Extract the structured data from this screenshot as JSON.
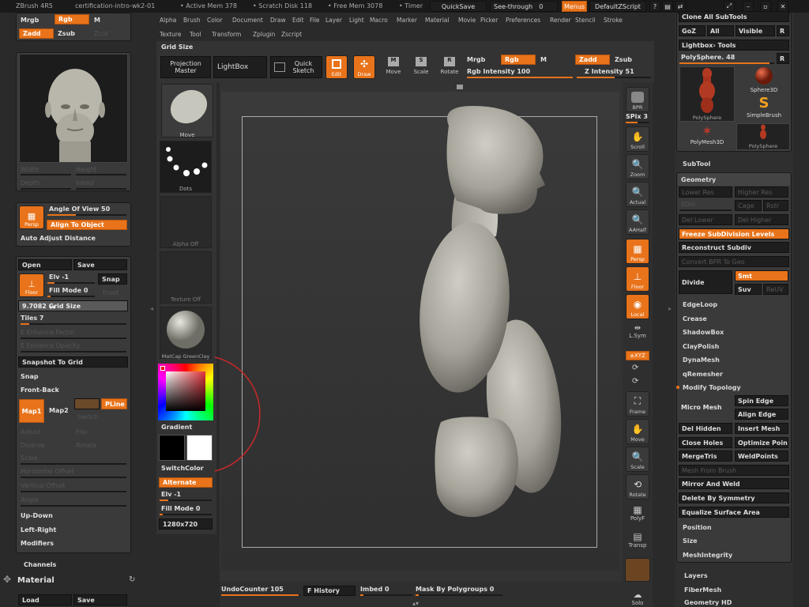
{
  "titlebar": {
    "app": "ZBrush 4R5",
    "file": "certification-intro-wk2-01",
    "active_mem": "• Active Mem 378",
    "scratch": "• Scratch Disk 118",
    "free_mem": "• Free Mem 3078",
    "timer": "• Timer",
    "quicksave": "QuickSave",
    "seethrough": "See-through",
    "seethrough_val": "0",
    "menus": "Menus",
    "zscript": "DefaultZScript"
  },
  "menu_row1": [
    "Alpha",
    "Brush",
    "Color",
    "Document",
    "Draw",
    "Edit",
    "File",
    "Layer",
    "Light",
    "Macro",
    "Marker",
    "Material",
    "Movie",
    "Picker",
    "Preferences",
    "Render",
    "Stencil",
    "Stroke"
  ],
  "menu_row2": [
    "Texture",
    "Tool",
    "Transform",
    "Zplugin",
    "Zscript"
  ],
  "shelf": {
    "grid_size": "Grid Size",
    "projection_master": "Projection Master",
    "lightbox": "LightBox",
    "quick_sketch": "Quick Sketch",
    "edit": "Edit",
    "draw": "Draw",
    "move": "Move",
    "scale": "Scale",
    "rotate": "Rotate",
    "mrgb": "Mrgb",
    "rgb": "Rgb",
    "m": "M",
    "zadd": "Zadd",
    "zsub": "Zsub",
    "rgb_intensity": "Rgb Intensity 100",
    "z_intensity": "Z Intensity 51"
  },
  "left": {
    "mrgb": "Mrgb",
    "rgb": "Rgb",
    "m": "M",
    "zadd": "Zadd",
    "zsub": "Zsub",
    "zcut": "Zcut",
    "width": "Width",
    "height": "Height",
    "depth": "Depth",
    "inbed": "Inbed",
    "persp": "Persp",
    "angle_of_view": "Angle Of View 50",
    "align_to_object": "Align To Object",
    "auto_adjust": "Auto Adjust Distance",
    "open": "Open",
    "save": "Save",
    "floor": "Floor",
    "elv": "Elv -1",
    "fill_mode": "Fill Mode 0",
    "snap": "Snap",
    "front": "Front",
    "grid_size": "9.7082 Grid Size",
    "tiles": "Tiles 7",
    "enhance_factor": "E Enhance Factor",
    "enhance_opacity": "E Enhance Opacity",
    "snapshot_to_grid": "Snapshot To Grid",
    "snap2": "Snap",
    "front_back": "Front-Back",
    "map1": "Map1",
    "map2": "Map2",
    "pline": "PLine",
    "switch": "Switch",
    "adjust": "Adjust",
    "flip": "Flip",
    "diverse": "Diverse",
    "rotate": "Rotate",
    "scale": "Scale",
    "h_offset": "Horizontal Offset",
    "v_offset": "Vertical Offset",
    "angle": "Angle",
    "up_down": "Up-Down",
    "left_right": "Left-Right",
    "modifiers": "Modifiers",
    "channels": "Channels",
    "material": "Material",
    "load": "Load",
    "save2": "Save"
  },
  "palette": {
    "move": "Move",
    "dots": "Dots",
    "alpha_off": "Alpha Off",
    "texture_off": "Texture Off",
    "matcap": "MatCap GreenClay",
    "gradient": "Gradient",
    "switch_color": "SwitchColor",
    "alternate": "Alternate",
    "elv": "Elv -1",
    "fill_mode": "Fill Mode 0",
    "doc_size": "1280x720"
  },
  "rightshelf": {
    "bpr": "BPR",
    "spix": "SPix 3",
    "scroll": "Scroll",
    "zoom": "Zoom",
    "actual": "Actual",
    "aahalf": "AAHalf",
    "persp": "Persp",
    "floor": "Floor",
    "local": "Local",
    "lsym": "L.Sym",
    "xyz": "±XYZ",
    "frame": "Frame",
    "move": "Move",
    "scale": "Scale",
    "rotate": "Rotate",
    "polyf": "PolyF",
    "transp": "Transp",
    "solo": "Solo"
  },
  "bottom": {
    "undo": "UndoCounter 105",
    "history": "F History",
    "imbed": "Imbed 0",
    "mask": "Mask By Polygroups 0"
  },
  "tool": {
    "clone_all": "Clone All SubTools",
    "goz": "GoZ",
    "all": "All",
    "visible": "Visible",
    "r": "R",
    "lightbox_tools": "Lightbox› Tools",
    "polysphere_label": "PolySphere. 48",
    "r2": "R",
    "thumbs": [
      "PolySphere",
      "Sphere3D",
      "SimpleBrush",
      "PolyMesh3D",
      "PolySphere"
    ],
    "subtool": "SubTool",
    "geometry": "Geometry",
    "lower_res": "Lower Res",
    "higher_res": "Higher Res",
    "sdiv": "SDiv",
    "cage": "Cage",
    "rstr": "Rstr",
    "del_lower": "Del Lower",
    "del_higher": "Del Higher",
    "freeze": "Freeze SubDivision Levels",
    "reconstruct": "Reconstruct Subdiv",
    "convert_bpr": "Convert BPR To Geo",
    "divide": "Divide",
    "smt": "Smt",
    "suv": "Suv",
    "reuv": "ReUV",
    "edgeloop": "EdgeLoop",
    "crease": "Crease",
    "shadowbox": "ShadowBox",
    "claypolish": "ClayPolish",
    "dynamesh": "DynaMesh",
    "qremesher": "qRemesher",
    "modify_topology": "Modify Topology",
    "spin_edge": "Spin Edge",
    "align_edge": "Align Edge",
    "micro_mesh": "Micro Mesh",
    "del_hidden": "Del Hidden",
    "insert_mesh": "Insert Mesh",
    "close_holes": "Close Holes",
    "optimize": "Optimize Poin",
    "mergetris": "MergeTris",
    "weldpoints": "WeldPoints",
    "mesh_from_brush": "Mesh From Brush",
    "mirror_weld": "Mirror And Weld",
    "delete_symmetry": "Delete By Symmetry",
    "equalize": "Equalize Surface Area",
    "position": "Position",
    "size": "Size",
    "meshintegrity": "MeshIntegrity",
    "layers": "Layers",
    "fibermesh": "FiberMesh",
    "geometry_hd": "Geometry HD"
  },
  "colors": {
    "accent": "#e8731a",
    "bg": "#2a2a2a",
    "panel": "#3a3a3a"
  }
}
